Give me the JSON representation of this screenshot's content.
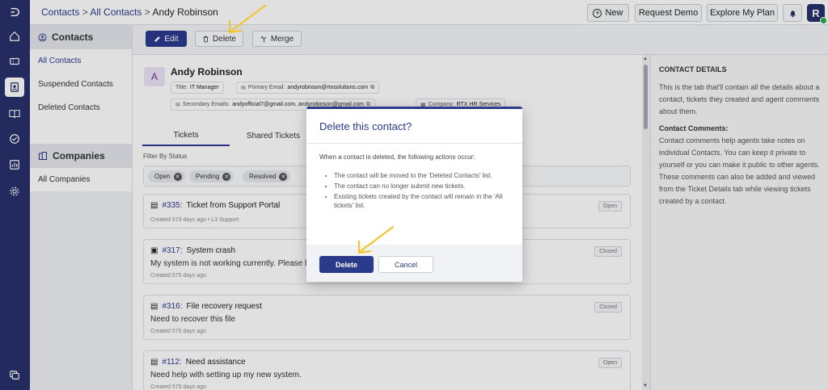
{
  "breadcrumb": {
    "root": "Contacts",
    "sep": ">",
    "section": "All Contacts",
    "current": "Andy Robinson"
  },
  "header": {
    "new_label": "New",
    "demo_label": "Request Demo",
    "plan_label": "Explore My Plan",
    "avatar_initial": "R"
  },
  "nav": {
    "contacts_heading": "Contacts",
    "contact_items": [
      "All Contacts",
      "Suspended Contacts",
      "Deleted Contacts"
    ],
    "companies_heading": "Companies",
    "company_items": [
      "All Companies"
    ]
  },
  "toolbar": {
    "edit_label": "Edit",
    "delete_label": "Delete",
    "merge_label": "Merge"
  },
  "contact": {
    "initial": "A",
    "name": "Andy Robinson",
    "title_label": "Title:",
    "title_value": "IT Manager",
    "primary_email_label": "Primary Email:",
    "primary_email": "andyrobinson@rtxsolutions.com",
    "secondary_label": "Secondary Emails:",
    "secondary_value": "andyofficial7@gmail.com, andyrobinson@gmail.com",
    "company_label": "Company:",
    "company_value": "RTX HR Services"
  },
  "tabs": [
    "Tickets",
    "Shared Tickets"
  ],
  "filter": {
    "label": "Filter By Status",
    "pills": [
      "Open",
      "Pending",
      "Resolved"
    ]
  },
  "tickets": [
    {
      "num": "#335:",
      "title": "Ticket from Support Portal",
      "desc": "",
      "meta": "Created 573 days ago  •  L3 Support",
      "status": "Open"
    },
    {
      "num": "#317:",
      "title": "System crash",
      "desc": "My system is not working currently. Please look",
      "meta": "Created 575 days ago",
      "status": "Closed"
    },
    {
      "num": "#316:",
      "title": "File recovery request",
      "desc": "Need to recover this file",
      "meta": "Created 575 days ago",
      "status": "Closed"
    },
    {
      "num": "#112:",
      "title": "Need assistance",
      "desc": "Need help with setting up my new system.",
      "meta": "Created 575 days ago",
      "status": "Open"
    }
  ],
  "right_panel": {
    "heading": "CONTACT DETAILS",
    "intro": "This is the tab that'll contain all the details about a contact, tickets they created and agent comments about them.",
    "comments_heading": "Contact Comments:",
    "comments_text": "Contact comments help agents take notes on individual Contacts. You can keep it private to yourself or you can make it public to other agents. These comments can also be added and viewed from the Ticket Details tab while viewing tickets created by a contact."
  },
  "modal": {
    "title": "Delete this contact?",
    "intro": "When a contact is deleted, the following actions occur:",
    "bullets": [
      "The contact will be moved to the 'Deleted Contacts' list.",
      "The contact can no longer submit new tickets.",
      "Existing tickets created by the contact will remain in the 'All tickets' list."
    ],
    "delete_label": "Delete",
    "cancel_label": "Cancel"
  },
  "colors": {
    "primary": "#2c3a8c",
    "rail": "#27306b",
    "annotation_arrow": "#f2c531",
    "online": "#2eaa4a"
  }
}
